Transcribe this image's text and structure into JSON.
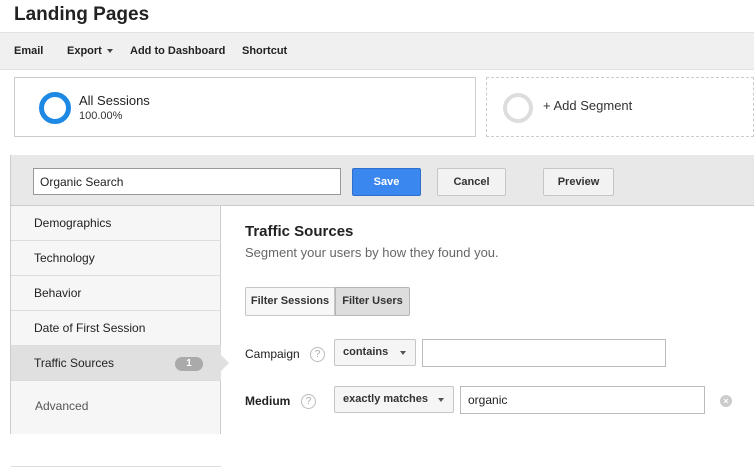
{
  "page": {
    "title": "Landing Pages"
  },
  "toolbar": {
    "email": "Email",
    "export": "Export",
    "add_to_dashboard": "Add to Dashboard",
    "shortcut": "Shortcut"
  },
  "segments": {
    "active": {
      "name": "All Sessions",
      "percent": "100.00%"
    },
    "add_label": "+ Add Segment"
  },
  "editor": {
    "segment_name": "Organic Search",
    "save": "Save",
    "cancel": "Cancel",
    "preview": "Preview"
  },
  "sidebar": {
    "items": [
      {
        "label": "Demographics"
      },
      {
        "label": "Technology"
      },
      {
        "label": "Behavior"
      },
      {
        "label": "Date of First Session"
      },
      {
        "label": "Traffic Sources",
        "badge": "1",
        "active": true
      }
    ],
    "advanced_label": "Advanced"
  },
  "main": {
    "title": "Traffic Sources",
    "subtitle": "Segment your users by how they found you.",
    "filter_sessions": "Filter Sessions",
    "filter_users": "Filter Users",
    "help_glyph": "?",
    "remove_glyph": "×",
    "conditions": [
      {
        "label": "Campaign",
        "operator": "contains",
        "value": ""
      },
      {
        "label": "Medium",
        "operator": "exactly matches",
        "value": "organic"
      }
    ]
  },
  "colors": {
    "accent_blue": "#3a87f0",
    "ring_blue": "#1e88e5"
  }
}
